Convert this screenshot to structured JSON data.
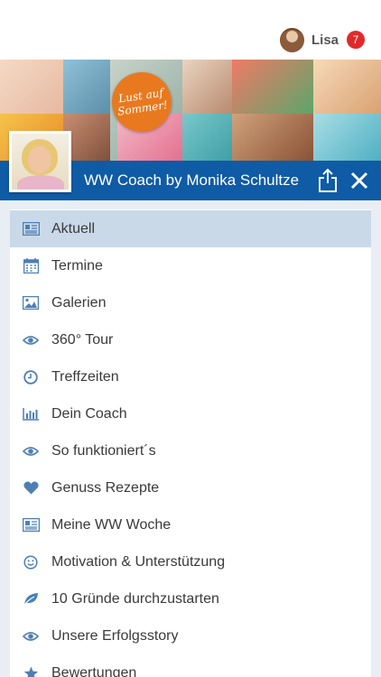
{
  "header": {
    "username": "Lisa",
    "notification_count": "7"
  },
  "banner": {
    "badge_line1": "Lust auf",
    "badge_line2": "Sommer!"
  },
  "titlebar": {
    "title": "WW Coach by Monika Schultze"
  },
  "menu": {
    "items": [
      {
        "label": "Aktuell",
        "icon": "newspaper-icon",
        "active": true
      },
      {
        "label": "Termine",
        "icon": "calendar-icon"
      },
      {
        "label": "Galerien",
        "icon": "image-icon"
      },
      {
        "label": "360° Tour",
        "icon": "eye-icon"
      },
      {
        "label": "Treffzeiten",
        "icon": "clock-icon"
      },
      {
        "label": "Dein Coach",
        "icon": "bar-chart-icon"
      },
      {
        "label": "So funktioniert´s",
        "icon": "eye-icon"
      },
      {
        "label": "Genuss Rezepte",
        "icon": "heart-icon"
      },
      {
        "label": "Meine WW Woche",
        "icon": "newspaper-icon"
      },
      {
        "label": "Motivation & Unterstützung",
        "icon": "smiley-icon"
      },
      {
        "label": "10 Gründe durchzustarten",
        "icon": "leaf-icon"
      },
      {
        "label": "Unsere Erfolgsstory",
        "icon": "eye-icon"
      },
      {
        "label": "Bewertungen",
        "icon": "star-icon"
      }
    ]
  },
  "colors": {
    "brand_blue": "#0f5ba6",
    "icon_blue": "#4d7fb5",
    "active_row": "#c9d9e8",
    "badge_red": "#e02a2a",
    "sommer_orange": "#e8791f"
  }
}
